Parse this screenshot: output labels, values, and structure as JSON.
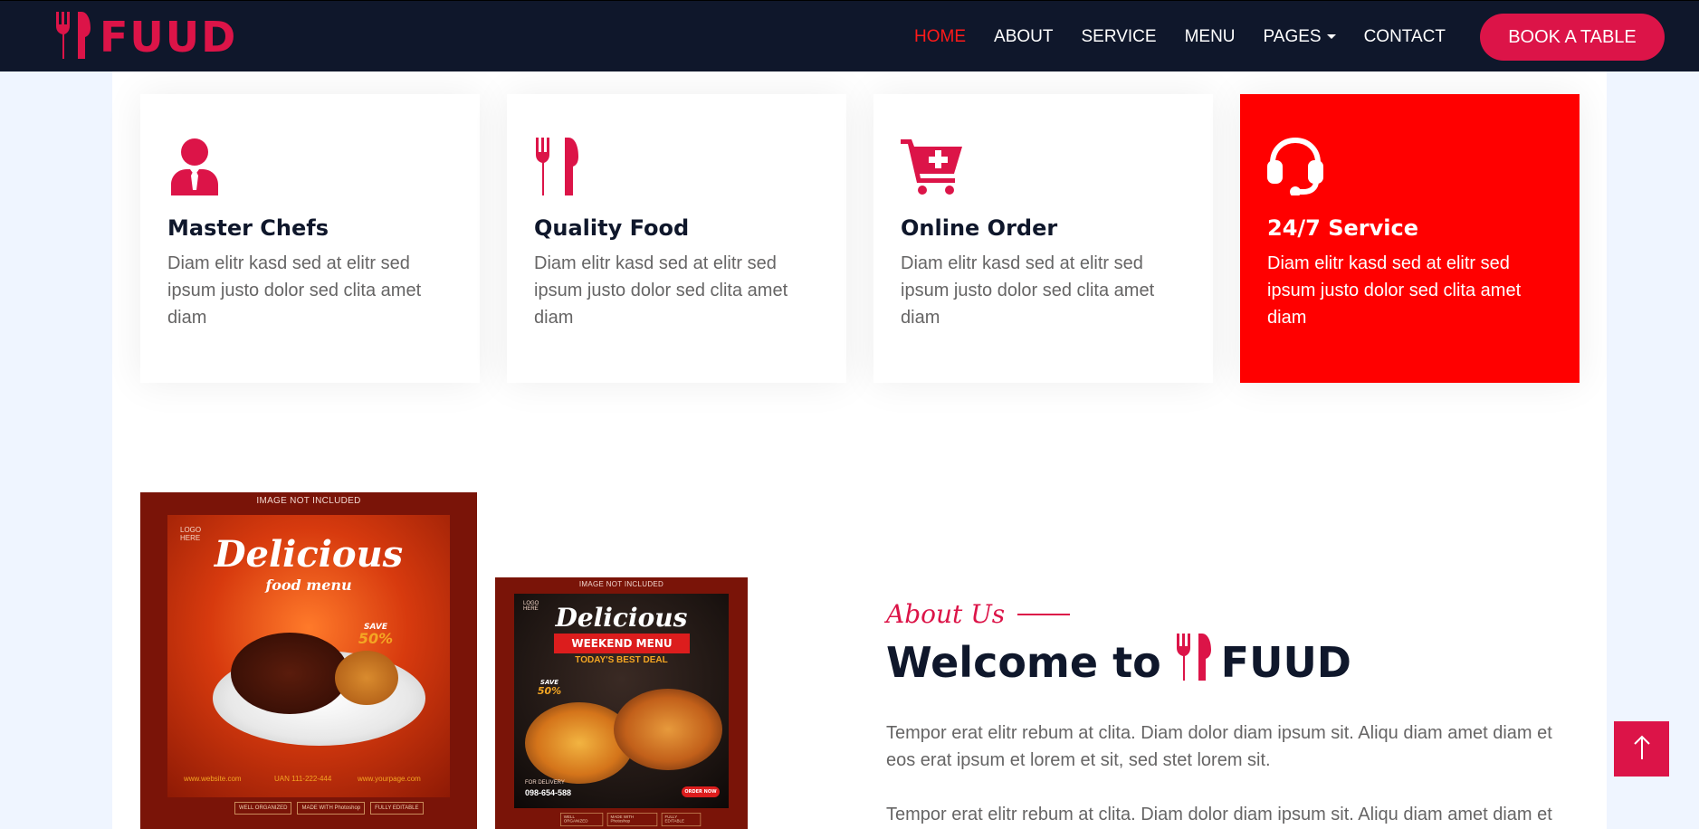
{
  "brand": {
    "name": "FUUD",
    "color": "#dc1448"
  },
  "nav": {
    "links": [
      "HOME",
      "ABOUT",
      "SERVICE",
      "MENU",
      "PAGES",
      "CONTACT"
    ],
    "active": "HOME",
    "book_label": "BOOK A TABLE"
  },
  "services": [
    {
      "icon": "user-tie-icon",
      "title": "Master Chefs",
      "text": "Diam elitr kasd sed at elitr sed ipsum justo dolor sed clita amet diam"
    },
    {
      "icon": "utensils-icon",
      "title": "Quality Food",
      "text": "Diam elitr kasd sed at elitr sed ipsum justo dolor sed clita amet diam"
    },
    {
      "icon": "cart-plus-icon",
      "title": "Online Order",
      "text": "Diam elitr kasd sed at elitr sed ipsum justo dolor sed clita amet diam"
    },
    {
      "icon": "headset-icon",
      "title": "24/7 Service",
      "text": "Diam elitr kasd sed at elitr sed ipsum justo dolor sed clita amet diam",
      "highlight": true,
      "highlight_color": "#ff0000"
    }
  ],
  "posters": {
    "first": {
      "note": "IMAGE NOT INCLUDED",
      "headline": "Delicious",
      "subheadline": "food menu",
      "save_label": "SAVE",
      "save_value": "50%",
      "logo_text": "LOGO HERE",
      "website": "www.website.com",
      "phone": "UAN 111-222-444",
      "page": "www.yourpage.com",
      "badges": [
        "WELL ORGANIZED",
        "MADE WITH Photoshop",
        "FULLY EDITABLE"
      ]
    },
    "second": {
      "note": "IMAGE NOT INCLUDED",
      "headline": "Delicious",
      "banner": "WEEKEND MENU",
      "deal": "TODAY'S BEST DEAL",
      "save_label": "SAVE",
      "save_value": "50%",
      "logo_text": "LOGO HERE",
      "delivery_label": "FOR DELIVERY",
      "phone": "098-654-588",
      "order_label": "ORDER NOW",
      "badges": [
        "WELL ORGANIZED",
        "MADE WITH Photoshop",
        "FULLY EDITABLE"
      ]
    }
  },
  "about": {
    "label": "About Us",
    "welcome_prefix": "Welcome to",
    "welcome_brand": "FUUD",
    "paragraphs": [
      "Tempor erat elitr rebum at clita. Diam dolor diam ipsum sit. Aliqu diam amet diam et eos erat ipsum et lorem et sit, sed stet lorem sit.",
      "Tempor erat elitr rebum at clita. Diam dolor diam ipsum sit. Aliqu diam amet diam et"
    ]
  },
  "back_to_top": {
    "icon": "arrow-up-icon"
  }
}
